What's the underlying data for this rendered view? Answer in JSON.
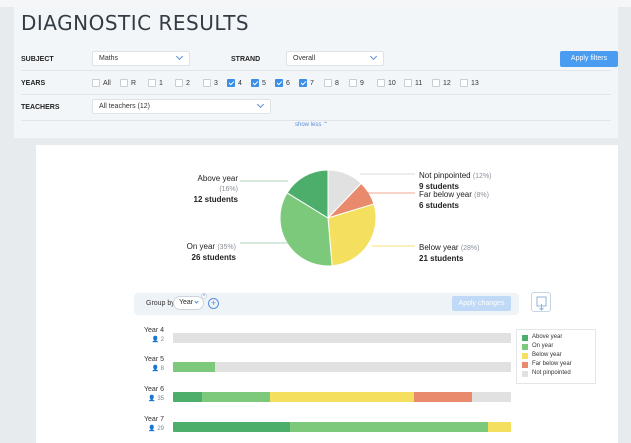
{
  "title": "DIAGNOSTIC RESULTS",
  "filters": {
    "subject_label": "SUBJECT",
    "subject_value": "Maths",
    "strand_label": "STRAND",
    "strand_value": "Overall",
    "years_label": "YEARS",
    "teachers_label": "TEACHERS",
    "teachers_value": "All teachers (12)",
    "apply_label": "Apply filters",
    "show_less": "show less ⌃",
    "years": [
      {
        "label": "All",
        "checked": false
      },
      {
        "label": "R",
        "checked": false
      },
      {
        "label": "1",
        "checked": false
      },
      {
        "label": "2",
        "checked": false
      },
      {
        "label": "3",
        "checked": false
      },
      {
        "label": "4",
        "checked": true
      },
      {
        "label": "5",
        "checked": true
      },
      {
        "label": "6",
        "checked": true
      },
      {
        "label": "7",
        "checked": true
      },
      {
        "label": "8",
        "checked": false
      },
      {
        "label": "9",
        "checked": false
      },
      {
        "label": "10",
        "checked": false
      },
      {
        "label": "11",
        "checked": false
      },
      {
        "label": "12",
        "checked": false
      },
      {
        "label": "13",
        "checked": false
      }
    ]
  },
  "pie": {
    "above": {
      "label": "Above year",
      "pct": "(16%)",
      "students": "12 students"
    },
    "on": {
      "label": "On year",
      "pct": "(35%)",
      "students": "26 students"
    },
    "not": {
      "label": "Not pinpointed",
      "pct": "(12%)",
      "students": "9 students"
    },
    "far": {
      "label": "Far below year",
      "pct": "(8%)",
      "students": "6 students"
    },
    "below": {
      "label": "Below year",
      "pct": "(28%)",
      "students": "21 students"
    }
  },
  "colors": {
    "above": "#4cae6a",
    "on": "#7cc97b",
    "below": "#f4e05e",
    "far": "#ea8a6c",
    "not": "#e1e1e1"
  },
  "group": {
    "group_by_label": "Group by",
    "group_value": "Year",
    "apply_changes": "Apply changes"
  },
  "chart_data": {
    "type": "bar",
    "categories": [
      "Year 4",
      "Year 5",
      "Year 6",
      "Year 7"
    ],
    "counts": [
      "2",
      "8",
      "35",
      "29"
    ],
    "series": [
      {
        "name": "Above year",
        "values": [
          0,
          0,
          3,
          10
        ]
      },
      {
        "name": "On year",
        "values": [
          0,
          1,
          7,
          17
        ]
      },
      {
        "name": "Below year",
        "values": [
          0,
          0,
          15,
          2
        ]
      },
      {
        "name": "Far below year",
        "values": [
          0,
          0,
          6,
          0
        ]
      },
      {
        "name": "Not pinpointed",
        "values": [
          2,
          7,
          4,
          0
        ]
      }
    ]
  },
  "legend": [
    "Above year",
    "On year",
    "Below year",
    "Far below year",
    "Not pinpointed"
  ]
}
